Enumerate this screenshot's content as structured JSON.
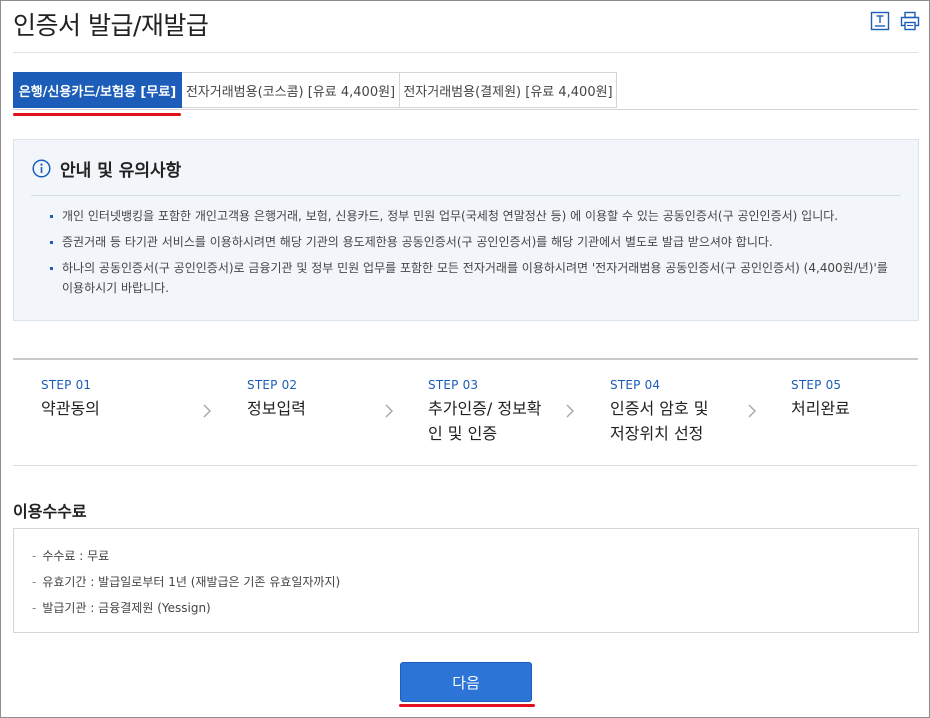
{
  "page": {
    "title": "인증서 발급/재발급"
  },
  "toolbar": {
    "icons": [
      "download-icon",
      "print-icon"
    ]
  },
  "tabs": [
    {
      "label": "은행/신용카드/보험용 [무료]",
      "active": true
    },
    {
      "label": "전자거래범용(코스콤) [유료 4,400원]",
      "active": false
    },
    {
      "label": "전자거래범용(결제원) [유료 4,400원]",
      "active": false
    }
  ],
  "notice": {
    "title": "안내 및 유의사항",
    "items": [
      "개인 인터넷뱅킹을 포함한 개인고객용 은행거래, 보험, 신용카드, 정부 민원 업무(국세청 연말정산 등) 에 이용할 수 있는 공동인증서(구 공인인증서) 입니다.",
      "증권거래 등 타기관 서비스를 이용하시려면 해당 기관의 용도제한용 공동인증서(구 공인인증서)를 해당 기관에서 별도로 발급 받으셔야 합니다.",
      "하나의 공동인증서(구 공인인증서)로 금융기관 및 정부 민원 업무를 포함한 모든 전자거래를 이용하시려면 '전자거래범용 공동인증서(구 공인인증서) (4,400원/년)'를 이용하시기 바랍니다."
    ]
  },
  "steps": [
    {
      "label": "STEP 01",
      "name": "약관동의"
    },
    {
      "label": "STEP 02",
      "name": "정보입력"
    },
    {
      "label": "STEP 03",
      "name": "추가인증/ 정보확인 및 인증"
    },
    {
      "label": "STEP 04",
      "name": "인증서 암호 및 저장위치 선정"
    },
    {
      "label": "STEP 05",
      "name": "처리완료"
    }
  ],
  "fee": {
    "title": "이용수수료",
    "items": [
      "수수료 : 무료",
      "유효기간 : 발급일로부터 1년 (재발급은 기존 유효일자까지)",
      "발급기관 : 금융결제원 (Yessign)"
    ]
  },
  "next_button": {
    "label": "다음"
  },
  "colors": {
    "accent": "#1b5db8",
    "button": "#2c74d6",
    "highlight_underline": "#e0111b",
    "notice_bg": "#f2f6fb"
  }
}
